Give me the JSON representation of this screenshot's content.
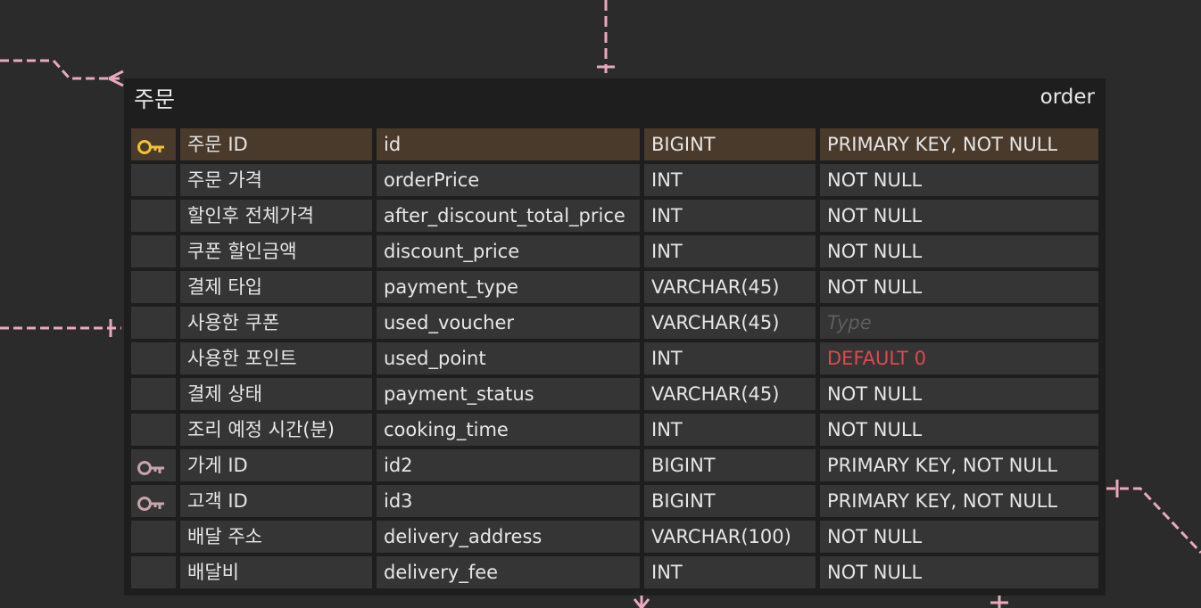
{
  "table": {
    "logical_name": "주문",
    "physical_name": "order",
    "columns": [
      {
        "logical": "주문 ID",
        "physical": "id",
        "type": "BIGINT",
        "option": "PRIMARY KEY, NOT NULL",
        "key": "primary",
        "option_style": "normal"
      },
      {
        "logical": "주문 가격",
        "physical": "orderPrice",
        "type": "INT",
        "option": "NOT NULL",
        "key": "none",
        "option_style": "normal"
      },
      {
        "logical": "할인후 전체가격",
        "physical": "after_discount_total_price",
        "type": "INT",
        "option": "NOT NULL",
        "key": "none",
        "option_style": "normal"
      },
      {
        "logical": "쿠폰 할인금액",
        "physical": "discount_price",
        "type": "INT",
        "option": "NOT NULL",
        "key": "none",
        "option_style": "normal"
      },
      {
        "logical": "결제 타입",
        "physical": "payment_type",
        "type": "VARCHAR(45)",
        "option": "NOT NULL",
        "key": "none",
        "option_style": "normal"
      },
      {
        "logical": "사용한 쿠폰",
        "physical": "used_voucher",
        "type": "VARCHAR(45)",
        "option": "Type",
        "key": "none",
        "option_style": "placeholder"
      },
      {
        "logical": "사용한 포인트",
        "physical": "used_point",
        "type": "INT",
        "option": "DEFAULT 0",
        "key": "none",
        "option_style": "default"
      },
      {
        "logical": "결제 상태",
        "physical": "payment_status",
        "type": "VARCHAR(45)",
        "option": "NOT NULL",
        "key": "none",
        "option_style": "normal"
      },
      {
        "logical": "조리 예정 시간(분)",
        "physical": "cooking_time",
        "type": "INT",
        "option": "NOT NULL",
        "key": "none",
        "option_style": "normal"
      },
      {
        "logical": "가게 ID",
        "physical": "id2",
        "type": "BIGINT",
        "option": "PRIMARY KEY, NOT NULL",
        "key": "foreign",
        "option_style": "normal"
      },
      {
        "logical": "고객 ID",
        "physical": "id3",
        "type": "BIGINT",
        "option": "PRIMARY KEY, NOT NULL",
        "key": "foreign",
        "option_style": "normal"
      },
      {
        "logical": "배달 주소",
        "physical": "delivery_address",
        "type": "VARCHAR(100)",
        "option": "NOT NULL",
        "key": "none",
        "option_style": "normal"
      },
      {
        "logical": "배달비",
        "physical": "delivery_fee",
        "type": "INT",
        "option": "NOT NULL",
        "key": "none",
        "option_style": "normal"
      }
    ]
  },
  "colors": {
    "canvas": "#2b2b2b",
    "table_bg": "#1e1e1e",
    "cell_bg": "#353535",
    "pk_row_bg": "#4a3a2b",
    "relation_line": "#e8a9bd",
    "pk_icon": "#f2c230",
    "fk_icon": "#c9a3ad",
    "default_text": "#e0484f"
  }
}
